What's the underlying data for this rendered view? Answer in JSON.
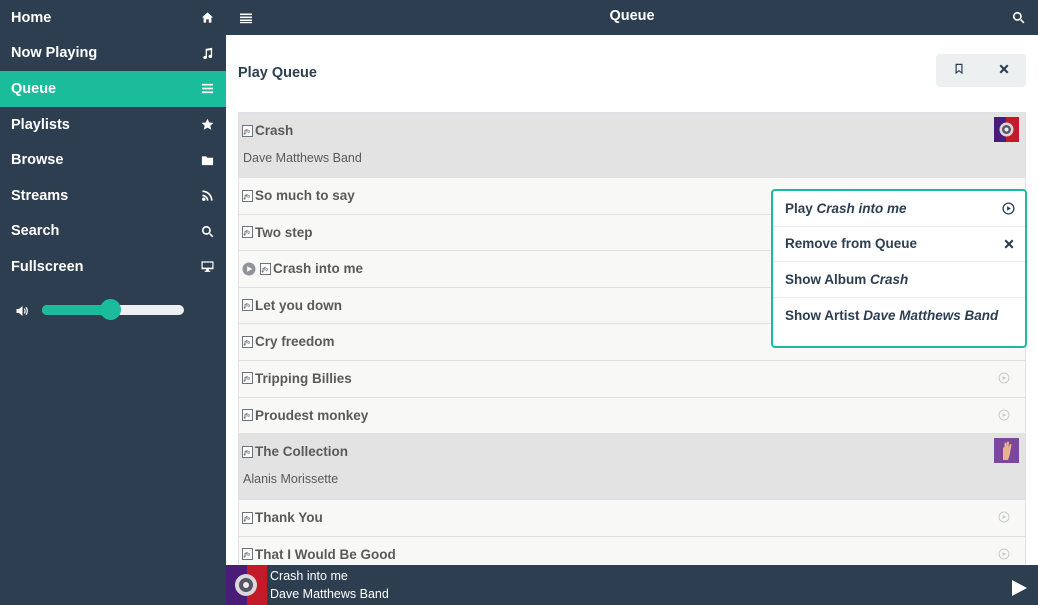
{
  "topbar": {
    "title": "Queue"
  },
  "sidebar": {
    "items": [
      {
        "label": "Home",
        "icon": "home-icon"
      },
      {
        "label": "Now Playing",
        "icon": "music-icon"
      },
      {
        "label": "Queue",
        "icon": "list-icon",
        "active": true
      },
      {
        "label": "Playlists",
        "icon": "star-icon"
      },
      {
        "label": "Browse",
        "icon": "folder-icon"
      },
      {
        "label": "Streams",
        "icon": "rss-icon"
      },
      {
        "label": "Search",
        "icon": "search-icon"
      },
      {
        "label": "Fullscreen",
        "icon": "desktop-icon"
      }
    ],
    "volume_level": 0.48
  },
  "main": {
    "heading": "Play Queue",
    "rows": [
      {
        "type": "album",
        "title": "Crash",
        "artist": "Dave Matthews Band",
        "cover": "dmb"
      },
      {
        "type": "track",
        "title": "So much to say"
      },
      {
        "type": "track",
        "title": "Two step"
      },
      {
        "type": "track",
        "title": "Crash into me",
        "playing": true
      },
      {
        "type": "track",
        "title": "Let you down"
      },
      {
        "type": "track",
        "title": "Cry freedom"
      },
      {
        "type": "track",
        "title": "Tripping Billies",
        "action": true
      },
      {
        "type": "track",
        "title": "Proudest monkey",
        "action": true
      },
      {
        "type": "album",
        "title": "The Collection",
        "artist": "Alanis Morissette",
        "cover": "alanis"
      },
      {
        "type": "track",
        "title": "Thank You",
        "action": true
      },
      {
        "type": "track",
        "title": "That I Would Be Good",
        "action": true
      }
    ]
  },
  "popover": {
    "play_prefix": "Play ",
    "play_target": "Crash into me",
    "remove_label": "Remove from Queue",
    "album_prefix": "Show Album ",
    "album_target": "Crash",
    "artist_prefix": "Show Artist ",
    "artist_target": "Dave Matthews Band"
  },
  "footer": {
    "track": "Crash into me",
    "artist": "Dave Matthews Band"
  },
  "colors": {
    "primary": "#2c3e50",
    "accent": "#1abc9c"
  }
}
